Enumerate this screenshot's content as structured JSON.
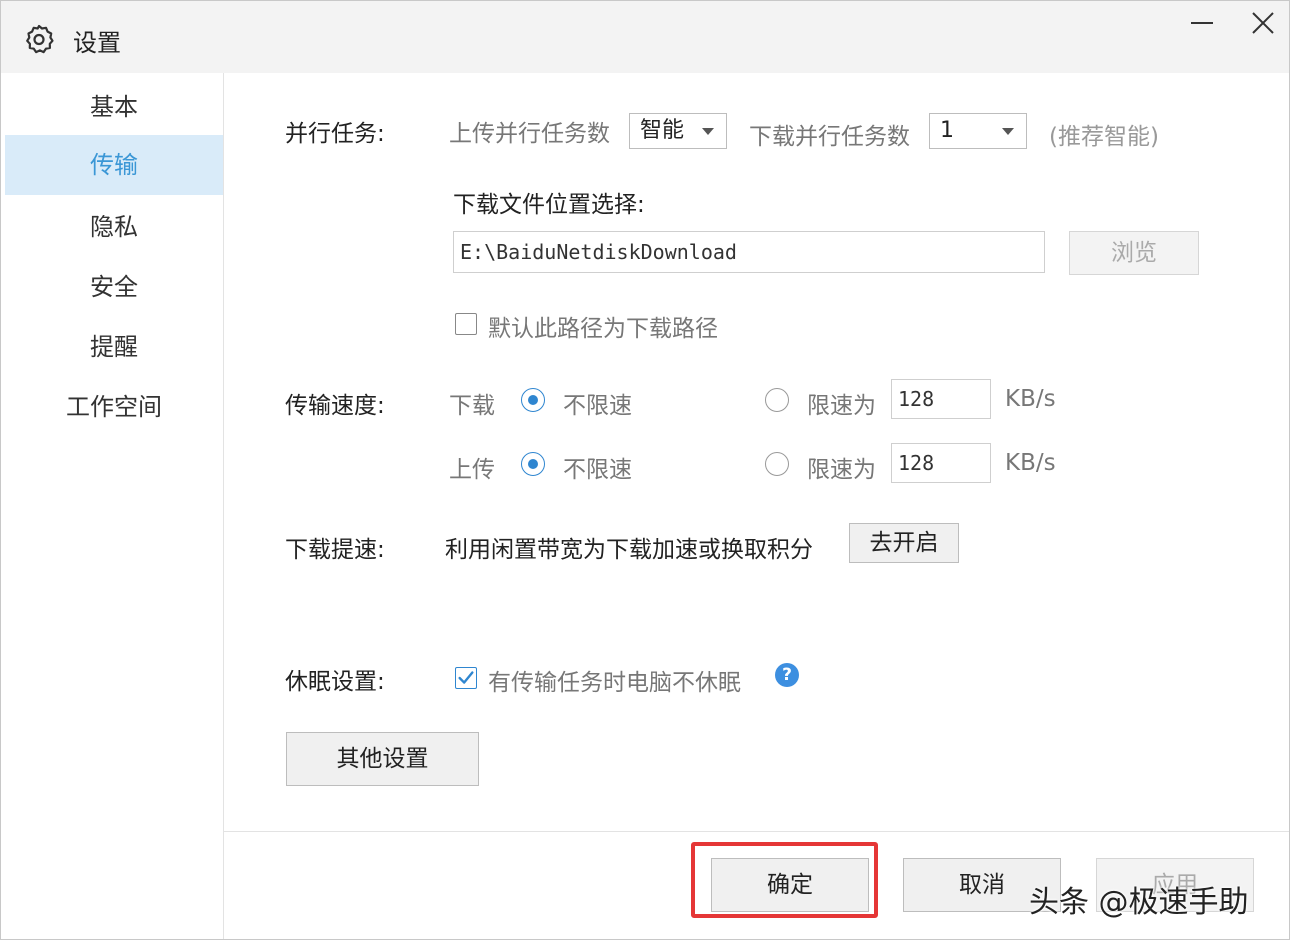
{
  "window": {
    "title": "设置"
  },
  "sidebar": {
    "items": [
      "基本",
      "传输",
      "隐私",
      "安全",
      "提醒",
      "工作空间"
    ],
    "active_index": 1
  },
  "parallel": {
    "label": "并行任务:",
    "upload_label": "上传并行任务数",
    "upload_value": "智能",
    "download_label": "下载并行任务数",
    "download_value": "1",
    "hint": "(推荐智能)"
  },
  "download_location": {
    "label": "下载文件位置选择:",
    "path": "E:\\BaiduNetdiskDownload",
    "browse_label": "浏览",
    "default_checkbox_label": "默认此路径为下载路径",
    "default_checked": false
  },
  "speed": {
    "label": "传输速度:",
    "download": {
      "label": "下载",
      "unlimited_label": "不限速",
      "limit_label": "限速为",
      "limit_value": "128",
      "unit": "KB/s"
    },
    "upload": {
      "label": "上传",
      "unlimited_label": "不限速",
      "limit_label": "限速为",
      "limit_value": "128",
      "unit": "KB/s"
    }
  },
  "boost": {
    "label": "下载提速:",
    "description": "利用闲置带宽为下载加速或换取积分",
    "button_label": "去开启"
  },
  "sleep": {
    "label": "休眠设置:",
    "checkbox_label": "有传输任务时电脑不休眠",
    "checked": true
  },
  "other_settings_label": "其他设置",
  "footer": {
    "ok_label": "确定",
    "cancel_label": "取消",
    "apply_label": "应用"
  },
  "watermark": "头条 @极速手助",
  "colors": {
    "accent": "#2f86d0",
    "active_nav_bg": "#d9ebf9",
    "highlight": "#e53636"
  }
}
